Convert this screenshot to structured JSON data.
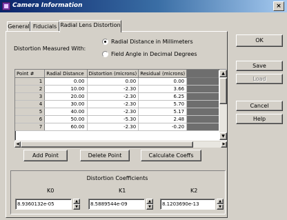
{
  "window": {
    "title": "Camera Information",
    "close_glyph": "×"
  },
  "tabs": [
    {
      "label": "General"
    },
    {
      "label": "Fiducials"
    },
    {
      "label": "Radial Lens Distortion"
    }
  ],
  "distortion": {
    "label": "Distortion Measured With:",
    "options": [
      {
        "label": "Radial Distance in Millimeters",
        "selected": true
      },
      {
        "label": "Field Angle in Decimal Degrees",
        "selected": false
      }
    ]
  },
  "table": {
    "columns": [
      "Point #",
      "Radial Distance",
      "Distortion (microns)",
      "Residual (microns)",
      ""
    ],
    "rows": [
      {
        "num": "1",
        "radial": "0.00",
        "distortion": "0.00",
        "residual": "0.00"
      },
      {
        "num": "2",
        "radial": "10.00",
        "distortion": "-2.30",
        "residual": "3.66"
      },
      {
        "num": "3",
        "radial": "20.00",
        "distortion": "-2.30",
        "residual": "6.25"
      },
      {
        "num": "4",
        "radial": "30.00",
        "distortion": "-2.30",
        "residual": "5.70"
      },
      {
        "num": "5",
        "radial": "40.00",
        "distortion": "-2.30",
        "residual": "5.17"
      },
      {
        "num": "6",
        "radial": "50.00",
        "distortion": "-5.30",
        "residual": "2.48"
      },
      {
        "num": "7",
        "radial": "60.00",
        "distortion": "-2.30",
        "residual": "-0.20"
      }
    ]
  },
  "buttons": {
    "add_point": "Add Point",
    "delete_point": "Delete Point",
    "calculate": "Calculate Coeffs",
    "ok": "OK",
    "save": "Save",
    "load": "Load",
    "cancel": "Cancel",
    "help": "Help"
  },
  "coefficients": {
    "title": "Distortion Coefficients",
    "k0": {
      "label": "K0",
      "value": "8.9360132e-05"
    },
    "k1": {
      "label": "K1",
      "value": "8.5889544e-09"
    },
    "k2": {
      "label": "K2",
      "value": "8.1203690e-13"
    }
  }
}
